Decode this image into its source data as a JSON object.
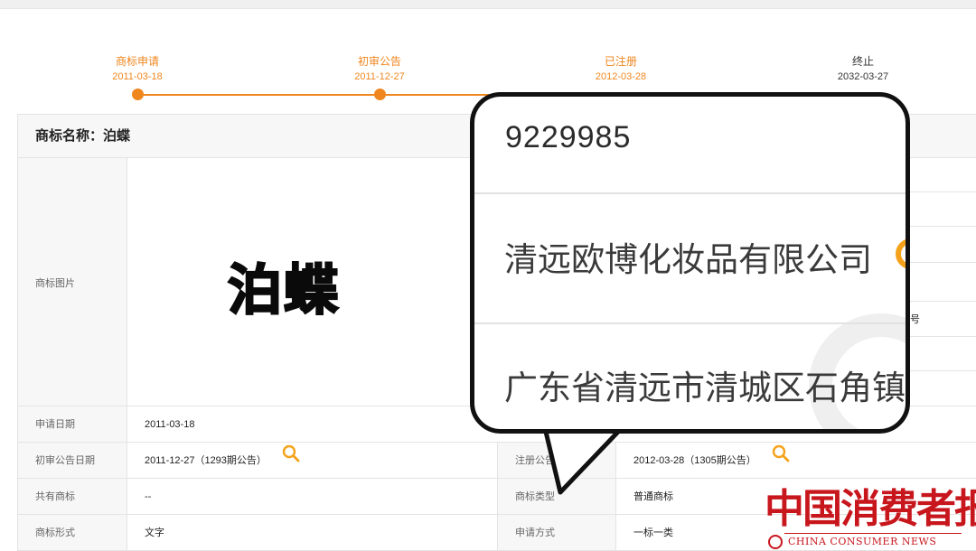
{
  "timeline": {
    "steps": [
      {
        "label": "商标申请",
        "date": "2011-03-18"
      },
      {
        "label": "初审公告",
        "date": "2011-12-27"
      },
      {
        "label": "已注册",
        "date": "2012-03-28"
      },
      {
        "label": "终止",
        "date": "2032-03-27"
      }
    ],
    "colors": {
      "active": "#f0861e",
      "inactive": "#333333"
    }
  },
  "detail": {
    "name_title": "商标名称：泊蝶",
    "image_label": "商标图片",
    "logo_text": "泊蝶",
    "rows": [
      {
        "label": "申请日期",
        "value": "2011-03-18"
      },
      {
        "label": "初审公告日期",
        "value": "2011-12-27（1293期公告）",
        "label2": "注册公告",
        "value2": "2012-03-28（1305期公告）"
      },
      {
        "label": "共有商标",
        "value": "--",
        "label2": "商标类型",
        "value2": "普通商标"
      },
      {
        "label": "商标形式",
        "value": "文字",
        "label2": "申请方式",
        "value2": "一标一类"
      }
    ],
    "partial_right_text": "号"
  },
  "bubble": {
    "registration_number": "9229985",
    "company": "清远欧博化妆品有限公司",
    "address": "广东省清远市清城区石角镇"
  },
  "watermark": {
    "cn": "中国消费者报",
    "en": "CHINA CONSUMER NEWS",
    "color": "#c8161d"
  }
}
